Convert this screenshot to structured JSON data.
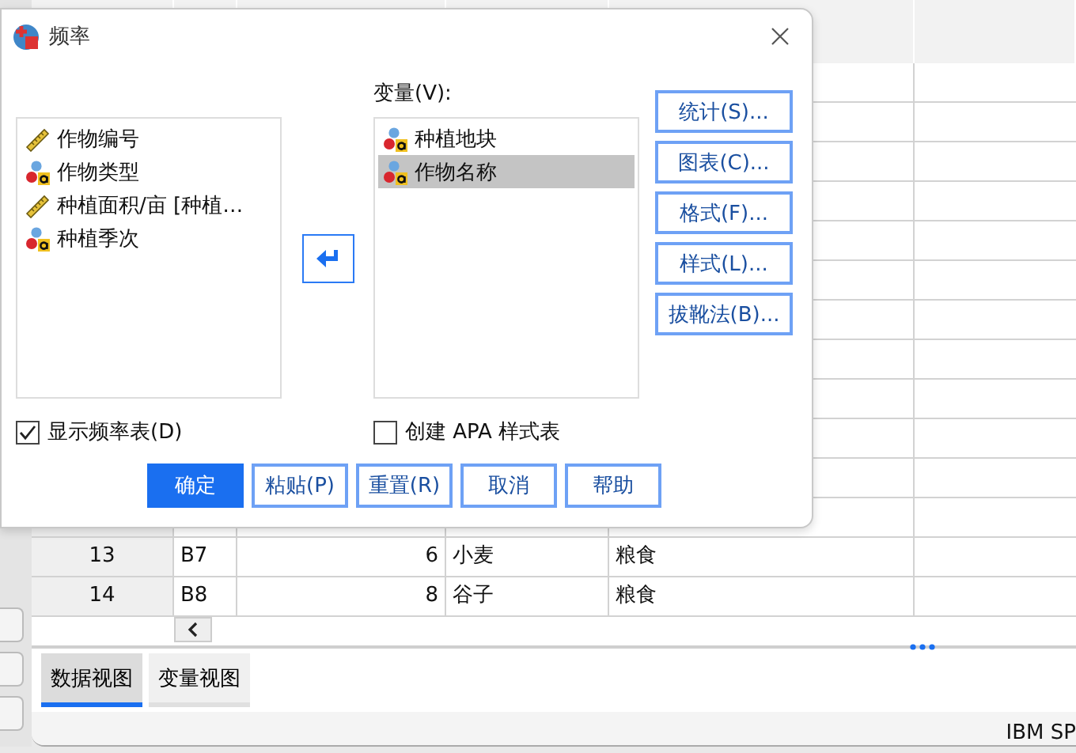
{
  "data_editor": {
    "rows": [
      {
        "number": "13",
        "cells": [
          "B7",
          "6",
          "小麦",
          "粮食",
          ""
        ]
      },
      {
        "number": "14",
        "cells": [
          "B8",
          "8",
          "谷子",
          "粮食",
          ""
        ]
      }
    ],
    "view_tabs": [
      {
        "label": "数据视图",
        "selected": true
      },
      {
        "label": "变量视图",
        "selected": false
      }
    ],
    "status_bar": "IBM SP"
  },
  "dialog": {
    "title": "频率",
    "source_variables": [
      {
        "name": "作物编号",
        "kind": "scale",
        "selected": false
      },
      {
        "name": "作物类型",
        "kind": "nominal",
        "selected": false
      },
      {
        "name": "种植面积/亩 [种植…",
        "kind": "scale",
        "selected": false
      },
      {
        "name": "种植季次",
        "kind": "nominal",
        "selected": false
      }
    ],
    "variables_label": "变量(V):",
    "target_variables": [
      {
        "name": "种植地块",
        "kind": "nominal",
        "selected": false
      },
      {
        "name": "作物名称",
        "kind": "nominal",
        "selected": true
      }
    ],
    "side_buttons": [
      "统计(S)...",
      "图表(C)...",
      "格式(F)...",
      "样式(L)...",
      "拔靴法(B)..."
    ],
    "checkboxes": [
      {
        "label": "显示频率表(D)",
        "checked": true
      },
      {
        "label": "创建 APA 样式表",
        "checked": false
      }
    ],
    "buttons": [
      {
        "label": "确定",
        "default": true
      },
      {
        "label": "粘贴(P)",
        "default": false
      },
      {
        "label": "重置(R)",
        "default": false
      },
      {
        "label": "取消",
        "default": false
      },
      {
        "label": "帮助",
        "default": false
      }
    ]
  }
}
